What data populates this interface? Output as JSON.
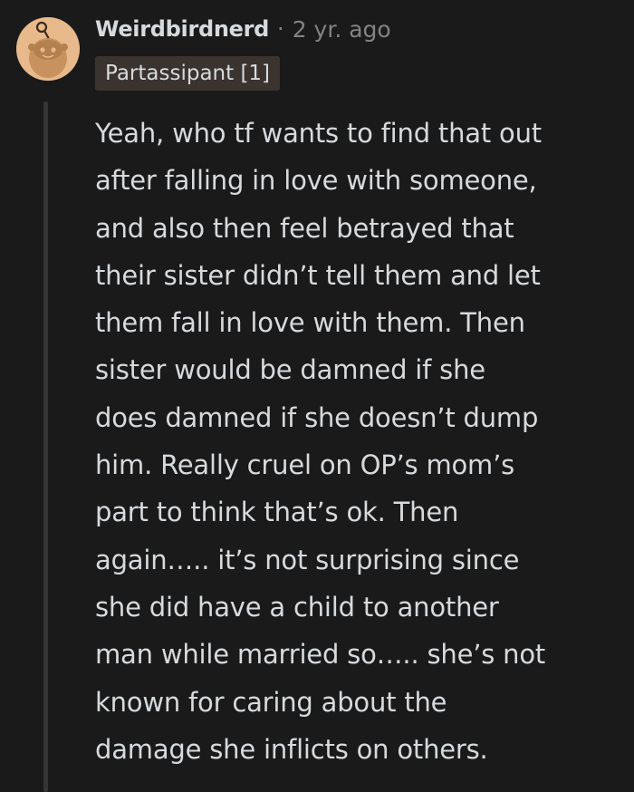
{
  "comment": {
    "author": "Weirdbirdnerd",
    "separator": "·",
    "timestamp": "2 yr. ago",
    "flair": "Partassipant [1]",
    "avatar_icon": "reddit-snoo-avatar-icon",
    "body_lines": [
      "Yeah, who tf wants to find that out",
      "after falling in love with someone,",
      "and also then feel betrayed that",
      "their sister didn’t tell them and let",
      "them fall in love with them. Then",
      "sister would be damned if she",
      "does damned if she doesn’t dump",
      "him. Really cruel on OP’s mom’s",
      "part to think that’s ok. Then",
      "again….. it’s not surprising since",
      "she did have a child to another",
      "man while married so….. she’s not",
      "known for caring about the",
      "damage she inflicts on others."
    ]
  },
  "colors": {
    "background": "#1a1a1b",
    "text": "#d7dadc",
    "meta": "#818384",
    "flair_bg": "#3a3330",
    "avatar_bg": "#e8b98a",
    "thread_line": "#343536"
  }
}
